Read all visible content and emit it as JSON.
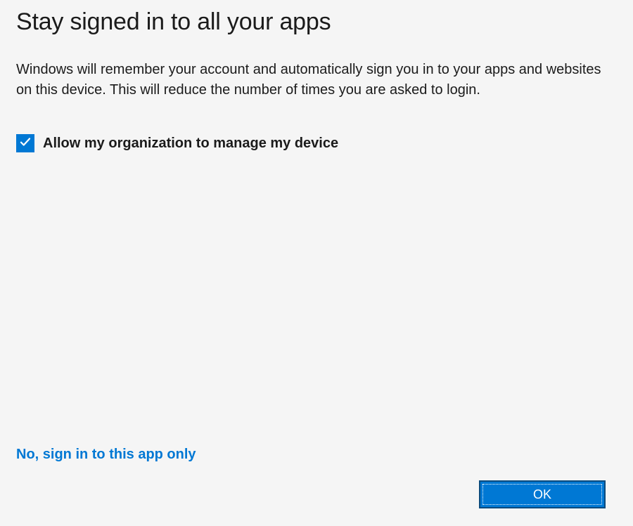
{
  "title": "Stay signed in to all your apps",
  "description": "Windows will remember your account and automatically sign you in to your apps and websites on this device. This will reduce the number of times you are asked to login.",
  "checkbox": {
    "label": "Allow my organization to manage my device",
    "checked": true
  },
  "link": "No, sign in to this app only",
  "ok_button": "OK",
  "colors": {
    "accent": "#0078d4",
    "background": "#f5f5f5",
    "text": "#1b1b1b"
  }
}
